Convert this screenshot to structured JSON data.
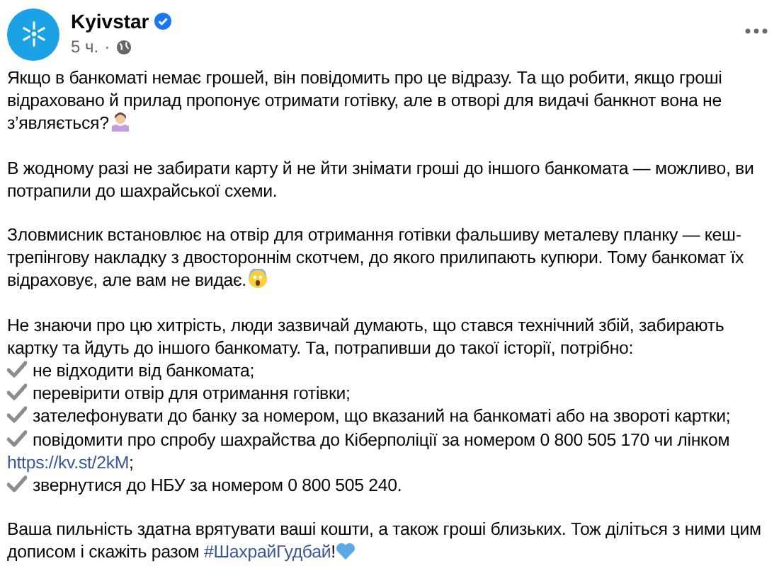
{
  "post": {
    "author": "Kyivstar",
    "verified": true,
    "time": "5 ч.",
    "time_separator": "·",
    "paragraphs": [
      {
        "text": "Якщо в банкоматі немає грошей, він повідомить про це відразу. Та що робити, якщо гроші відраховано й прилад пропонує отримати готівку, але в отворі для видачі банкнот вона не з’являється?",
        "kind": "shrug"
      },
      {
        "text": "В жодному разі не забирати карту й не йти знімати гроші до іншого банкомата — можливо, ви потрапили до шахрайської схеми.",
        "kind": "plain"
      },
      {
        "text": "Зловмисник встановлює на отвір для отримання готівки фальшиву металеву планку — кеш-трепінгову накладку з двостороннім скотчем, до якого прилипають купюри. Тому банкомат їх відраховує, але вам не видає.",
        "kind": "scream"
      }
    ],
    "intro": "Не знаючи про цю хитрість, люди зазвичай думають, що стався технічний збій, забирають картку та йдуть до іншого банкомату. Та, потрапивши до такої історії, потрібно:",
    "checklist": [
      {
        "text": "не відходити від банкомата;"
      },
      {
        "text": "перевірити отвір для отримання готівки;"
      },
      {
        "text": "зателефонувати до банку за номером, що вказаний на банкоматі або на звороті картки;"
      },
      {
        "text": "повідомити про спробу шахрайства до Кіберполіції за номером 0 800 505 170 чи лінком",
        "link": "https://kv.st/2kM",
        "suffix": ";"
      },
      {
        "text": "звернутися до НБУ за номером 0 800 505 240."
      }
    ],
    "closing": {
      "text": "Ваша пильність здатна врятувати ваші кошти, а також гроші близьких. Тож діліться з ними цим дописом і скажіть разом",
      "hashtag": "#ШахрайГудбай",
      "suffix": "!",
      "kind": "heart"
    }
  }
}
